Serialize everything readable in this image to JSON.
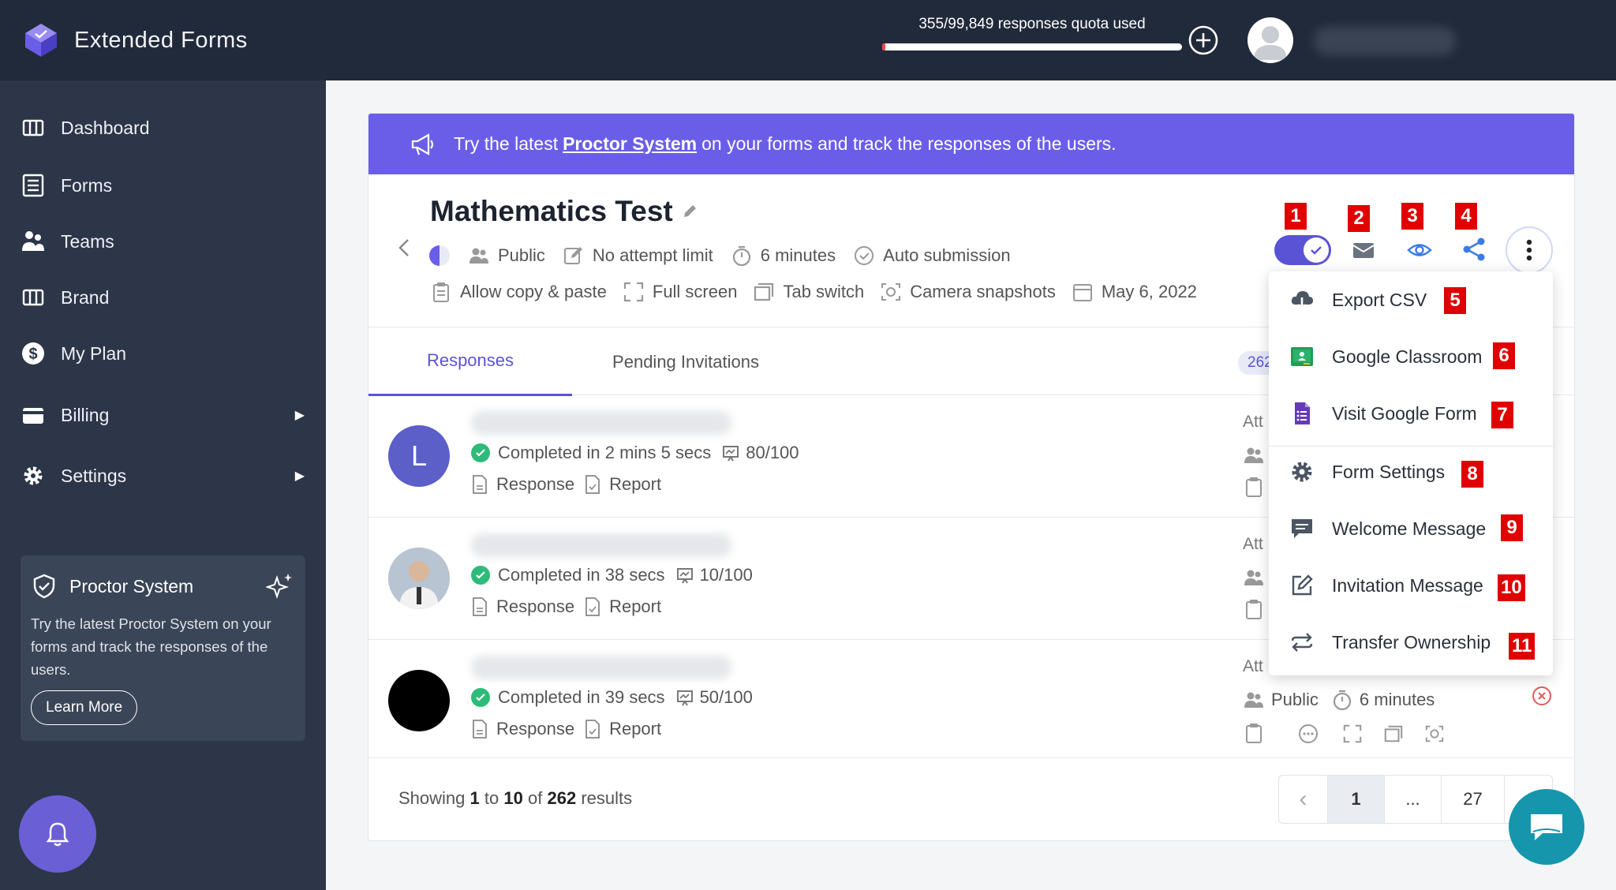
{
  "app": {
    "name": "Extended Forms"
  },
  "sidebar": {
    "items": [
      {
        "label": "Dashboard",
        "icon": "columns-icon"
      },
      {
        "label": "Forms",
        "icon": "form-icon"
      },
      {
        "label": "Teams",
        "icon": "teams-icon"
      },
      {
        "label": "Brand",
        "icon": "columns-icon"
      },
      {
        "label": "My Plan",
        "icon": "dollar-icon"
      },
      {
        "label": "Billing",
        "icon": "wallet-icon",
        "arrow": "▶"
      },
      {
        "label": "Settings",
        "icon": "gear-icon",
        "arrow": "▶"
      }
    ],
    "promo": {
      "title": "Proctor System",
      "text": "Try the latest Proctor System on your forms and track the responses of the users.",
      "button": "Learn More"
    }
  },
  "topbar": {
    "quota_text": "355/99,849 responses quota used",
    "quota_used": 355,
    "quota_total": 99849
  },
  "banner": {
    "prefix": "Try the latest",
    "link": "Proctor System",
    "suffix": "on your forms and track the responses of the users."
  },
  "form": {
    "title": "Mathematics Test",
    "meta1": [
      "Public",
      "No attempt limit",
      "6 minutes",
      "Auto submission"
    ],
    "meta2": [
      "Allow copy & paste",
      "Full screen",
      "Tab switch",
      "Camera snapshots",
      "May 6, 2022"
    ]
  },
  "tabs": {
    "responses": "Responses",
    "pending": "Pending Invitations",
    "count": "262"
  },
  "rows": [
    {
      "avatar_letter": "L",
      "status": "Completed in 2 mins 5 secs",
      "score": "80/100",
      "response": "Response",
      "report": "Report",
      "att": "Att"
    },
    {
      "avatar_letter": "",
      "status": "Completed in 38 secs",
      "score": "10/100",
      "response": "Response",
      "report": "Report",
      "att": "Att"
    },
    {
      "avatar_letter": "",
      "status": "Completed in 39 secs",
      "score": "50/100",
      "response": "Response",
      "report": "Report",
      "att": "Att",
      "access": "Public",
      "duration": "6 minutes"
    }
  ],
  "footer": {
    "showing": "Showing",
    "from": "1",
    "to_word": "to",
    "to": "10",
    "of_word": "of",
    "total": "262",
    "results": "results"
  },
  "pager": {
    "prev": "‹",
    "page": "1",
    "ellipsis": "...",
    "last": "27",
    "next": "›"
  },
  "menu": {
    "items": [
      "Export CSV",
      "Google Classroom",
      "Visit Google Form",
      "Form Settings",
      "Welcome Message",
      "Invitation Message",
      "Transfer Ownership"
    ]
  },
  "markers": [
    "1",
    "2",
    "3",
    "4",
    "5",
    "6",
    "7",
    "8",
    "9",
    "10",
    "11"
  ],
  "colors": {
    "accent": "#6a5ee8",
    "sidebar": "#2c3648",
    "topbar": "#212a3a",
    "success": "#2ebb7a",
    "marker": "#e00000"
  }
}
